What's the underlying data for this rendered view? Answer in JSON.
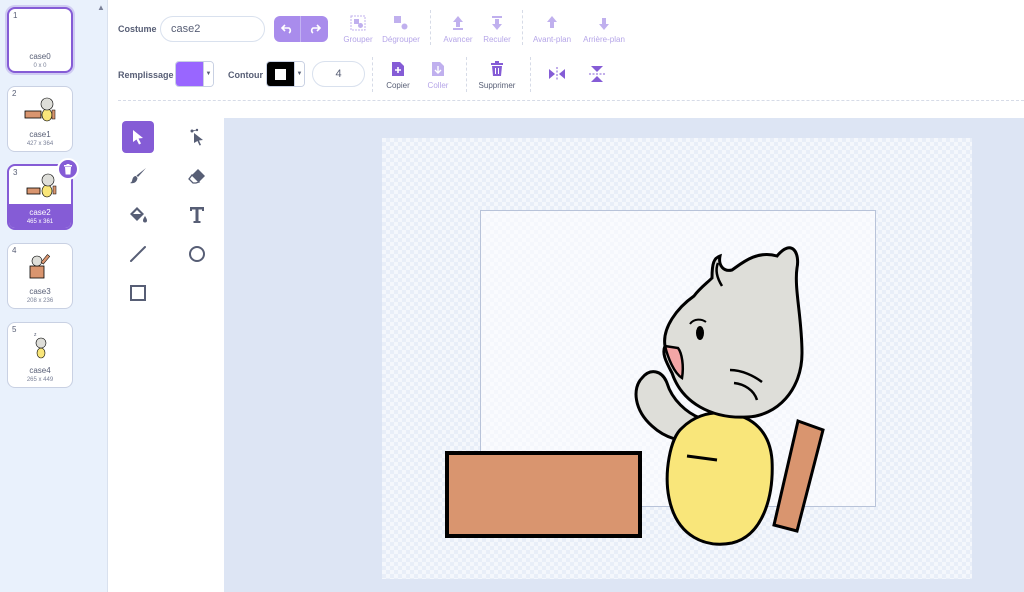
{
  "costumes": [
    {
      "index": "1",
      "name": "case0",
      "size": "0 x 0"
    },
    {
      "index": "2",
      "name": "case1",
      "size": "427 x 364"
    },
    {
      "index": "3",
      "name": "case2",
      "size": "465 x 361"
    },
    {
      "index": "4",
      "name": "case3",
      "size": "208 x 236"
    },
    {
      "index": "5",
      "name": "case4",
      "size": "265 x 449"
    }
  ],
  "toolbar": {
    "costume_label": "Costume",
    "costume_name": "case2",
    "group": "Grouper",
    "ungroup": "Dégrouper",
    "forward": "Avancer",
    "backward": "Reculer",
    "front": "Avant-plan",
    "back": "Arrière-plan",
    "fill_label": "Remplissage",
    "outline_label": "Contour",
    "outline_width": "4",
    "copy": "Copier",
    "paste": "Coller",
    "delete": "Supprimer"
  },
  "colors": {
    "accent": "#855cd6",
    "fill": "#9966ff",
    "outline": "#000000",
    "box": "#d9956f",
    "body": "#f9e67a",
    "head": "#deded9"
  },
  "icons": {
    "tools": [
      "select-icon",
      "reshape-icon",
      "brush-icon",
      "eraser-icon",
      "fill-icon",
      "text-icon",
      "line-icon",
      "circle-icon",
      "rectangle-icon"
    ]
  }
}
